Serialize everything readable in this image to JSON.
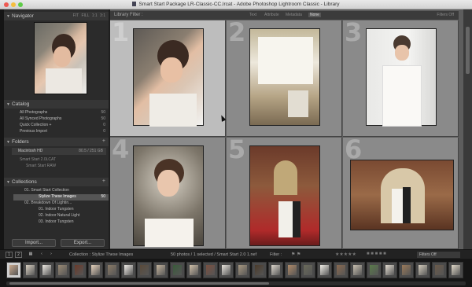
{
  "window": {
    "title": "Smart Start Package LR-Classic-CC.lrcat - Adobe Photoshop Lightroom Classic - Library"
  },
  "navigator": {
    "title": "Navigator",
    "options": [
      "FIT",
      "FILL",
      "1:1",
      "3:1"
    ]
  },
  "catalog": {
    "title": "Catalog",
    "items": [
      {
        "label": "All Photographs",
        "count": "50"
      },
      {
        "label": "All Synced Photographs",
        "count": "50"
      },
      {
        "label": "Quick Collection +",
        "count": "0"
      },
      {
        "label": "Previous Import",
        "count": "0"
      }
    ]
  },
  "folders": {
    "title": "Folders",
    "volume": {
      "label": "Macintosh HD",
      "info": "80.5 / 251 GB"
    },
    "items": [
      {
        "label": "Smart Start 2.0LCAT"
      },
      {
        "label": "Smart Start RAW"
      }
    ]
  },
  "collections": {
    "title": "Collections",
    "items": [
      {
        "label": "01. Smart Start Collection",
        "count": ""
      },
      {
        "label": "Stylize These Images",
        "count": "50"
      },
      {
        "label": "02. Breakdown Of Lightin...",
        "count": ""
      },
      {
        "label": "01. Indoor Tungsten",
        "count": ""
      },
      {
        "label": "02. Indoor Natural Light",
        "count": ""
      },
      {
        "label": "03. Indoor Tungsten",
        "count": ""
      }
    ]
  },
  "buttons": {
    "import": "Import...",
    "export": "Export..."
  },
  "filter_bar": {
    "label": "Library Filter :",
    "tabs": [
      "Text",
      "Attribute",
      "Metadata",
      "None"
    ],
    "active": "None",
    "right": "Filters Off"
  },
  "grid": {
    "cell_numbers": [
      "1",
      "2",
      "3",
      "4",
      "5",
      "6"
    ]
  },
  "toolbar": {
    "source": "Collection : Stylize These Images",
    "stats": "50 photos / 1 selected / Smart Start 2.0 1.nef",
    "filter_label": "Filter :",
    "stars": "★★★★★",
    "filters_off": "Filters Off",
    "page_buttons": [
      "1",
      "2"
    ]
  },
  "filmstrip": {
    "count": 28,
    "selected_index": 0
  },
  "colors": {
    "selected": "#bdbdbd",
    "panel": "#2b2b2b",
    "grid": "#5d5d5d"
  }
}
